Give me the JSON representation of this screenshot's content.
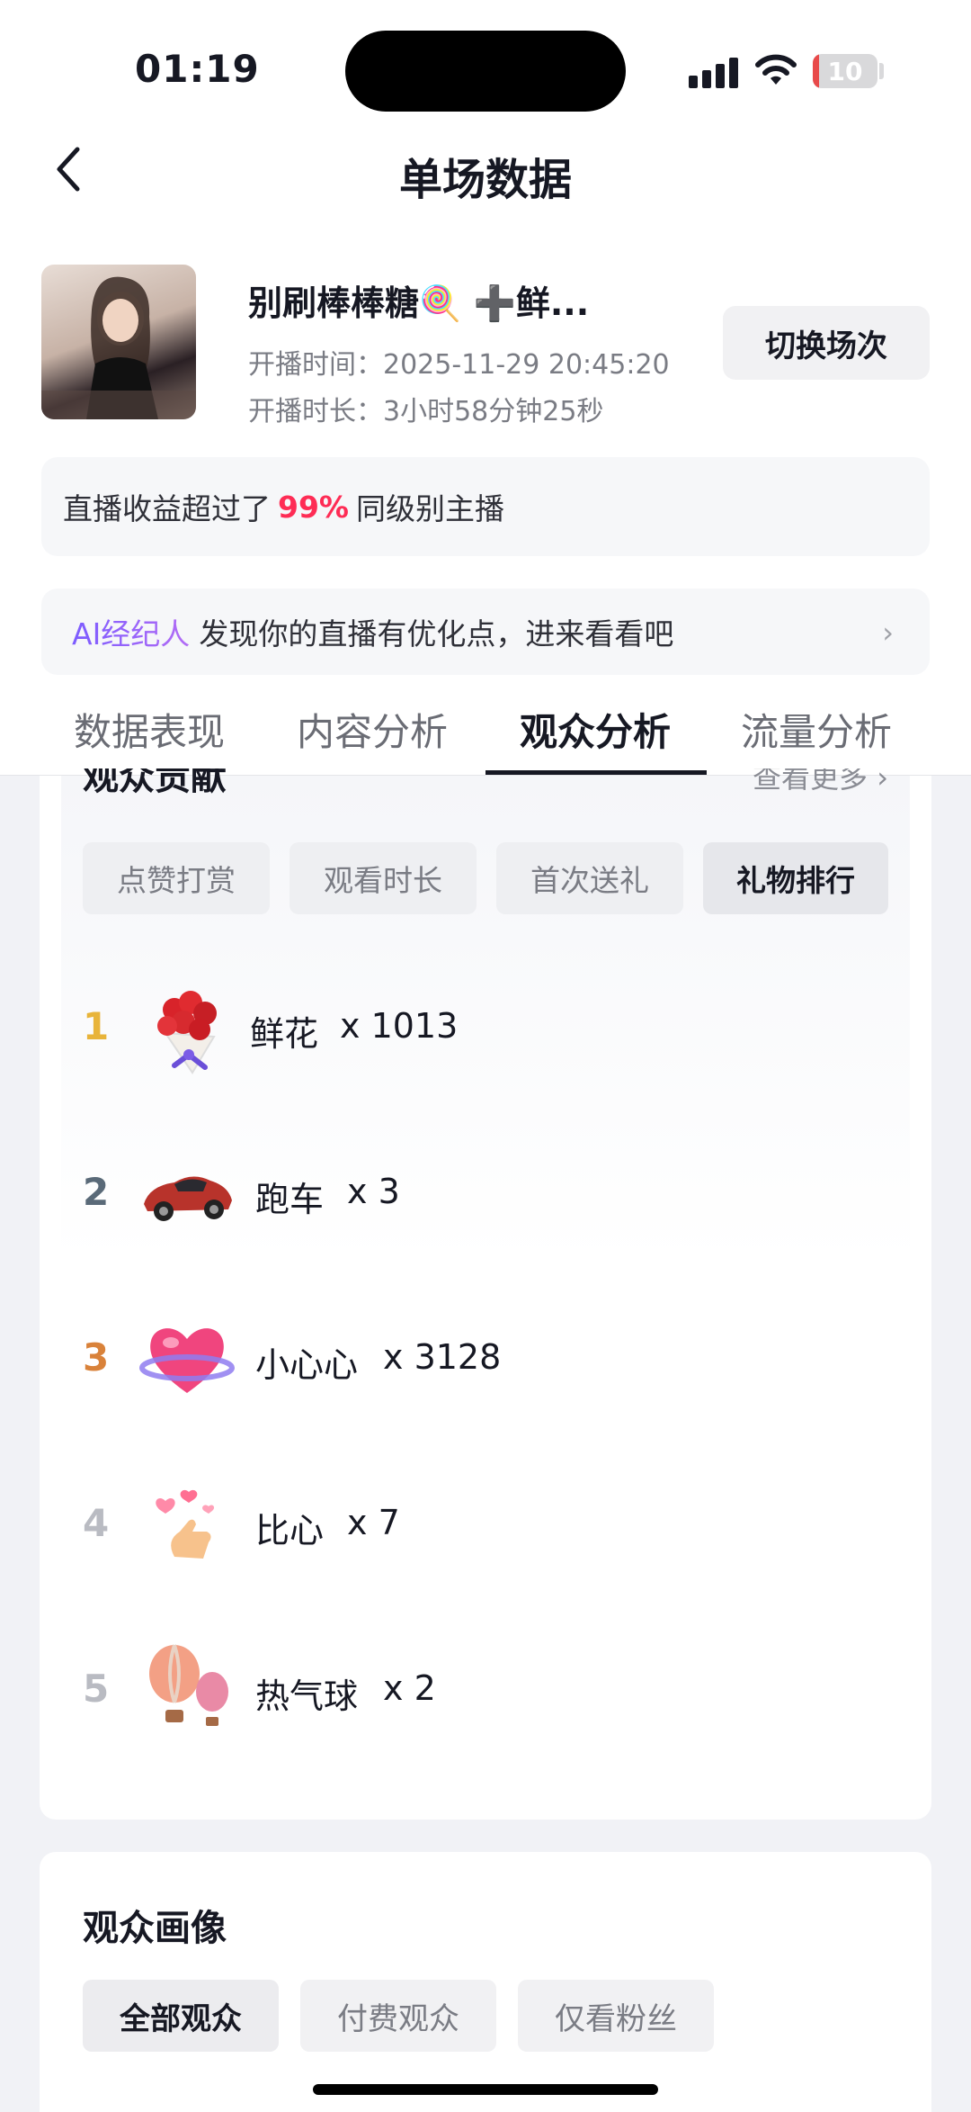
{
  "status_bar": {
    "time": "01:19",
    "battery": "10",
    "battery_level": 0.1
  },
  "header": {
    "title": "单场数据"
  },
  "live": {
    "host_name": "别刷棒棒糖🍭 ➕鲜...",
    "start_time": "开播时间：2025-11-29 20:45:20",
    "duration": "开播时长：3小时58分钟25秒",
    "switch_label": "切换场次"
  },
  "earnings": {
    "prefix": "直播收益超过了",
    "percent": "99%",
    "suffix": "同级别主播"
  },
  "ai_banner": {
    "ai_label": "AI经纪人",
    "text": "发现你的直播有优化点，进来看看吧",
    "chevron": "›"
  },
  "tabs": [
    {
      "label": "数据表现"
    },
    {
      "label": "内容分析"
    },
    {
      "label": "观众分析",
      "active": true
    },
    {
      "label": "流量分析"
    }
  ],
  "audience_contribution": {
    "title": "观众贡献",
    "more_label": "查看更多 ›",
    "chips": [
      {
        "label": "点赞打赏"
      },
      {
        "label": "观看时长"
      },
      {
        "label": "首次送礼"
      },
      {
        "label": "礼物排行",
        "active": true
      }
    ],
    "gifts": [
      {
        "rank": "1",
        "name": "鲜花",
        "count": "x 1013",
        "icon": "bouquet-icon",
        "rank_color": "#e8b43a"
      },
      {
        "rank": "2",
        "name": "跑车",
        "count": "x 3",
        "icon": "sports-car-icon",
        "rank_color": "#5a6a78"
      },
      {
        "rank": "3",
        "name": "小心心",
        "count": "x 3128",
        "icon": "heart-icon",
        "rank_color": "#d9823a"
      },
      {
        "rank": "4",
        "name": "比心",
        "count": "x 7",
        "icon": "finger-heart-icon",
        "rank_color": "#b9bbc2"
      },
      {
        "rank": "5",
        "name": "热气球",
        "count": "x 2",
        "icon": "hot-air-balloon-icon",
        "rank_color": "#b9bbc2"
      }
    ]
  },
  "audience_profile": {
    "title": "观众画像",
    "chips": [
      {
        "label": "全部观众",
        "active": true
      },
      {
        "label": "付费观众"
      },
      {
        "label": "仅看粉丝"
      }
    ]
  }
}
